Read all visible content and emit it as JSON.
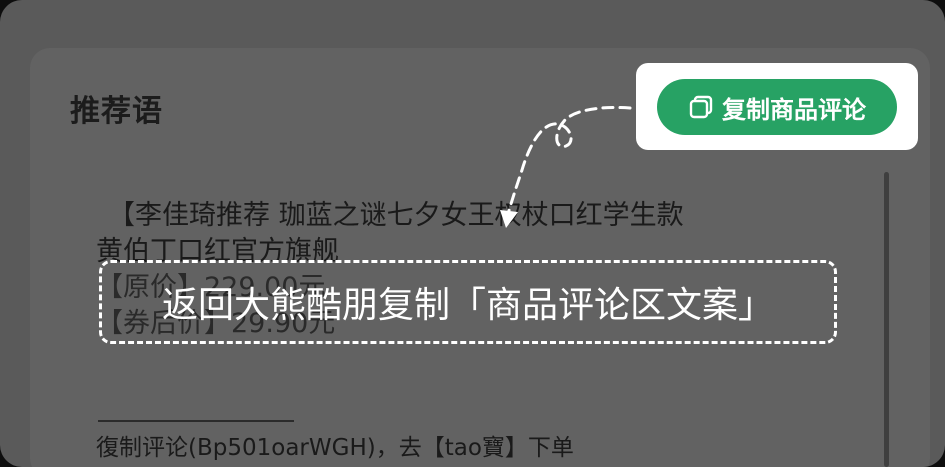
{
  "card": {
    "title": "推荐语",
    "recommendation_lines": [
      "【李佳琦推荐 珈蓝之谜七夕女王权杖口红学生款",
      "黄伯丁口红官方旗舰",
      "【原价】229.00元",
      "【券后价】29.90元"
    ],
    "copy_instruction": "復制评论(Bp501oarWGH)，去【tao寶】下单"
  },
  "copy_button": {
    "label": "复制商品评论",
    "icon": "copy-icon",
    "color": "#27a264"
  },
  "banner": {
    "text": "返回大熊酷朋复制「商品评论区文案」"
  }
}
